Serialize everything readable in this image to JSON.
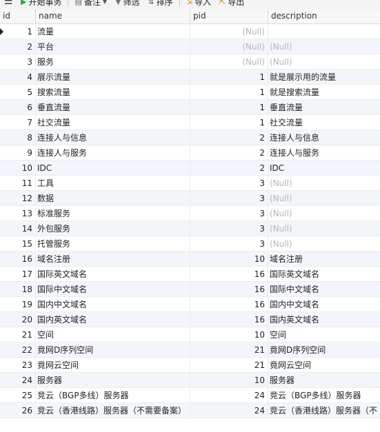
{
  "toolbar": {
    "menu_icon": "hamburger-icon",
    "begin_transaction": "开始事务",
    "note": "备注",
    "filter": "筛选",
    "sort": "排序",
    "import": "导入",
    "export": "导出"
  },
  "columns": [
    "id",
    "name",
    "pid",
    "description"
  ],
  "null_label": "(Null)",
  "rows": [
    {
      "id": "1",
      "name": "流量",
      "pid": null,
      "description": ""
    },
    {
      "id": "2",
      "name": "平台",
      "pid": null,
      "description": null
    },
    {
      "id": "3",
      "name": "服务",
      "pid": null,
      "description": null
    },
    {
      "id": "4",
      "name": "展示流量",
      "pid": "1",
      "description": "就是展示用的流量"
    },
    {
      "id": "5",
      "name": "搜索流量",
      "pid": "1",
      "description": "就是搜索流量"
    },
    {
      "id": "6",
      "name": "垂直流量",
      "pid": "1",
      "description": "垂直流量"
    },
    {
      "id": "7",
      "name": "社交流量",
      "pid": "1",
      "description": "社交流量"
    },
    {
      "id": "8",
      "name": "连接人与信息",
      "pid": "2",
      "description": "连接人与信息"
    },
    {
      "id": "9",
      "name": "连接人与服务",
      "pid": "2",
      "description": "连接人与服务"
    },
    {
      "id": "10",
      "name": "IDC",
      "pid": "2",
      "description": "IDC"
    },
    {
      "id": "11",
      "name": "工具",
      "pid": "3",
      "description": null
    },
    {
      "id": "12",
      "name": "数据",
      "pid": "3",
      "description": null
    },
    {
      "id": "13",
      "name": "标准服务",
      "pid": "3",
      "description": null
    },
    {
      "id": "14",
      "name": "外包服务",
      "pid": "3",
      "description": null
    },
    {
      "id": "15",
      "name": "托管服务",
      "pid": "3",
      "description": null
    },
    {
      "id": "16",
      "name": "域名注册",
      "pid": "10",
      "description": "域名注册"
    },
    {
      "id": "17",
      "name": "国际英文域名",
      "pid": "16",
      "description": "国际英文域名"
    },
    {
      "id": "18",
      "name": "国际中文域名",
      "pid": "16",
      "description": "国际中文域名"
    },
    {
      "id": "19",
      "name": "国内中文域名",
      "pid": "16",
      "description": "国内中文域名"
    },
    {
      "id": "20",
      "name": "国内英文域名",
      "pid": "16",
      "description": "国内英文域名"
    },
    {
      "id": "21",
      "name": "空间",
      "pid": "10",
      "description": "空间"
    },
    {
      "id": "22",
      "name": "竟网D序列空间",
      "pid": "21",
      "description": "竟网D序列空间"
    },
    {
      "id": "23",
      "name": "竟网云空间",
      "pid": "21",
      "description": "竟网云空间"
    },
    {
      "id": "24",
      "name": "服务器",
      "pid": "10",
      "description": "服务器"
    },
    {
      "id": "25",
      "name": "竞云（BGP多线）服务器",
      "pid": "24",
      "description": "竞云（BGP多线）服务器"
    },
    {
      "id": "26",
      "name": "竞云（香港线路）服务器（不需要备案）",
      "pid": "24",
      "description": "竞云（香港线路）服务器（不"
    }
  ]
}
